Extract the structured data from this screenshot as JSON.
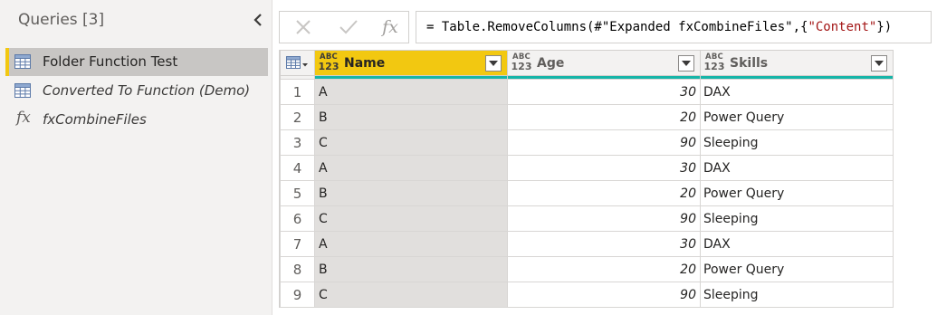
{
  "queries": {
    "title": "Queries [3]",
    "items": [
      {
        "label": "Folder Function Test",
        "icon": "table-icon",
        "selected": true,
        "italic": false
      },
      {
        "label": "Converted To Function (Demo)",
        "icon": "table-icon",
        "selected": false,
        "italic": true
      },
      {
        "label": "fxCombineFiles",
        "icon": "function-icon",
        "selected": false,
        "italic": true
      }
    ]
  },
  "formula_bar": {
    "cancel_icon": "close-icon",
    "commit_icon": "check-icon",
    "fx_label": "fx",
    "prefix": "= Table.RemoveColumns(#\"Expanded fxCombineFiles\",{",
    "string_literal": "\"Content\"",
    "suffix": "})"
  },
  "grid": {
    "type_label_abc": "ABC",
    "type_label_123": "123",
    "columns": [
      {
        "name": "Name"
      },
      {
        "name": "Age"
      },
      {
        "name": "Skills"
      }
    ],
    "rows": [
      {
        "n": "1",
        "name": "A",
        "age": "30",
        "skills": "DAX"
      },
      {
        "n": "2",
        "name": "B",
        "age": "20",
        "skills": "Power Query"
      },
      {
        "n": "3",
        "name": "C",
        "age": "90",
        "skills": "Sleeping"
      },
      {
        "n": "4",
        "name": "A",
        "age": "30",
        "skills": "DAX"
      },
      {
        "n": "5",
        "name": "B",
        "age": "20",
        "skills": "Power Query"
      },
      {
        "n": "6",
        "name": "C",
        "age": "90",
        "skills": "Sleeping"
      },
      {
        "n": "7",
        "name": "A",
        "age": "30",
        "skills": "DAX"
      },
      {
        "n": "8",
        "name": "B",
        "age": "20",
        "skills": "Power Query"
      },
      {
        "n": "9",
        "name": "C",
        "age": "90",
        "skills": "Sleeping"
      }
    ]
  },
  "colors": {
    "accent": "#f2c811",
    "quality_bar": "#16b5a8",
    "pane_bg": "#f3f2f1",
    "selected_bg": "#c8c6c4"
  }
}
